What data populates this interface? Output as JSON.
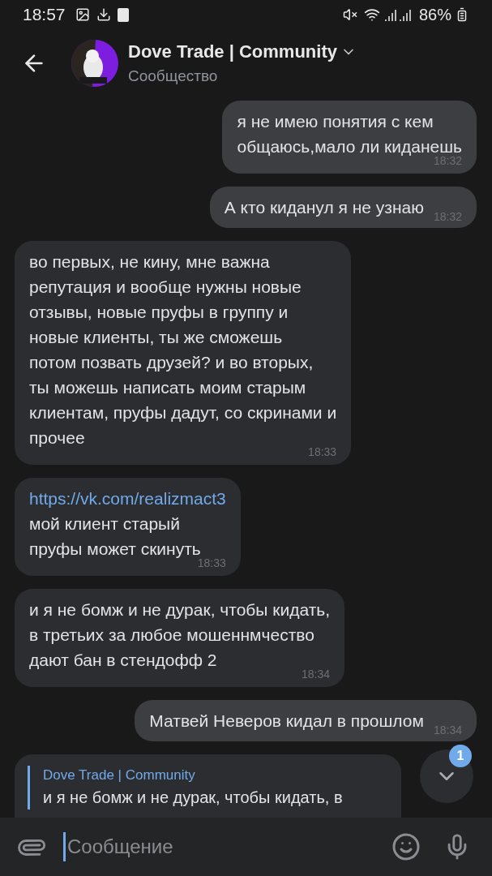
{
  "status_bar": {
    "time": "18:57",
    "battery": "86%"
  },
  "header": {
    "title": "Dove Trade | Community",
    "subtitle": "Сообщество"
  },
  "messages": [
    {
      "kind": "out",
      "lines": [
        "я не имею понятия с кем",
        "общаюсь,мало ли киданешь"
      ],
      "time": "18:32"
    },
    {
      "kind": "out",
      "lines": [
        "А кто киданул я не узнаю"
      ],
      "time": "18:32"
    },
    {
      "kind": "in",
      "lines": [
        "во первых, не кину, мне важна",
        "репутация и вообще нужны новые",
        "отзывы, новые пруфы в группу и",
        "новые клиенты, ты же сможешь",
        "потом позвать друзей? и во вторых,",
        "ты можешь написать моим старым",
        "клиентам, пруфы дадут, со скринами и",
        "прочее"
      ],
      "time": "18:33"
    },
    {
      "kind": "in",
      "link": "https://vk.com/realizmact3",
      "lines": [
        "мой клиент старый",
        "пруфы может скинуть"
      ],
      "time": "18:33"
    },
    {
      "kind": "in",
      "lines": [
        "и я не бомж и не дурак, чтобы кидать,",
        "в третьих за любое мошеннмчество",
        "дают бан в стендофф 2"
      ],
      "time": "18:34"
    },
    {
      "kind": "out",
      "lines": [
        "Матвей Неверов кидал в прошлом"
      ],
      "time": "18:34"
    }
  ],
  "partial_reply": {
    "author": "Dove Trade | Community",
    "quote": "и я не бомж и не дурак, чтобы кидать, в"
  },
  "scroll_badge": "1",
  "composer": {
    "placeholder": "Сообщение"
  }
}
